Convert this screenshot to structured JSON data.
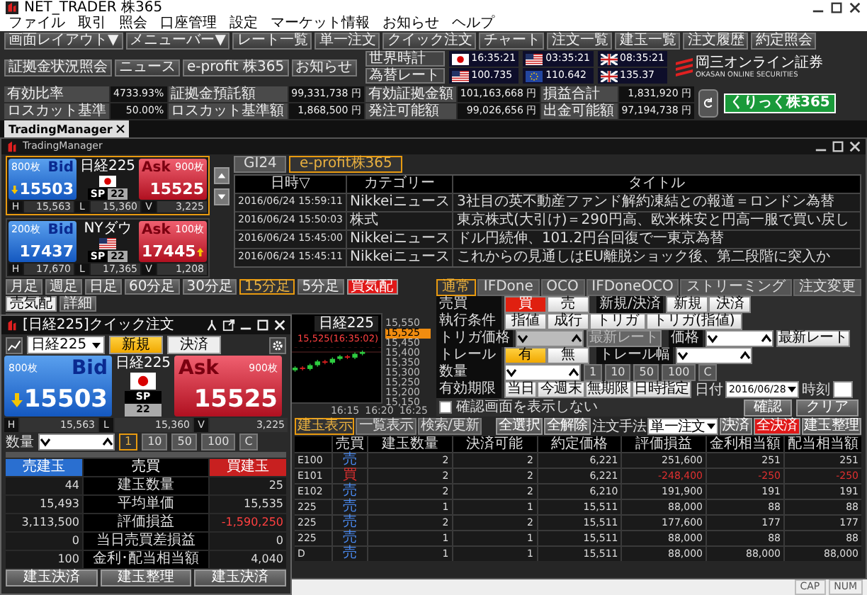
{
  "window": {
    "title": "NET_TRADER 株365"
  },
  "menu": [
    "ファイル",
    "取引",
    "照会",
    "口座管理",
    "設定",
    "マーケット情報",
    "お知らせ",
    "ヘルプ"
  ],
  "toolbar": [
    "画面レイアウト▼",
    "メニューバー▼",
    "レート一覧",
    "単一注文",
    "クイック注文",
    "チャート",
    "注文一覧",
    "建玉一覧",
    "注文履歴",
    "約定照会",
    "証拠金状況照会",
    "ニュース",
    "e-profit 株365",
    "お知らせ"
  ],
  "clocks": {
    "world_label": "世界時計",
    "times": [
      {
        "kind": "japan",
        "value": "16:35:21"
      },
      {
        "kind": "usa",
        "value": "03:35:21"
      },
      {
        "kind": "uk",
        "value": "08:35:21"
      }
    ],
    "fx_label": "為替レート",
    "rates": [
      {
        "kind": "usa",
        "value": "100.735"
      },
      {
        "kind": "eu",
        "value": "110.642"
      },
      {
        "kind": "uk",
        "value": "135.37"
      }
    ]
  },
  "logos": {
    "broker": "岡三オンライン証券",
    "broker_sub": "OKASAN ONLINE SECURITIES",
    "product": "くりっく株365"
  },
  "account": [
    {
      "label": "有効比率",
      "value": "4733.93%"
    },
    {
      "label": "証拠金預託額",
      "value": "99,331,738 円"
    },
    {
      "label": "有効証拠金額",
      "value": "101,163,668 円"
    },
    {
      "label": "損益合計",
      "value": "1,831,920 円"
    },
    {
      "label": "ロスカット基準",
      "value": "50.00%"
    },
    {
      "label": "ロスカット基準額",
      "value": "1,868,500 円"
    },
    {
      "label": "発注可能額",
      "value": "99,026,656 円"
    },
    {
      "label": "出金可能額",
      "value": "97,194,738 円"
    }
  ],
  "document_tabs": [
    {
      "label": "TradingManager",
      "selected": true
    }
  ],
  "trading_manager": {
    "title": "TradingManager",
    "quotes": [
      {
        "selected": true,
        "bid_qty": "800枚",
        "bid_label": "Bid",
        "bid": "15503",
        "bid_arrow": {
          "kind": "down"
        },
        "name": "日経225",
        "flag": {
          "kind": "japan"
        },
        "sp_label": "SP",
        "sp": "22",
        "ask_label": "Ask",
        "ask_qty": "900枚",
        "ask": "15525",
        "stats": [
          {
            "label": "H",
            "value": "15,563"
          },
          {
            "label": "L",
            "value": "15,360"
          },
          {
            "label": "V",
            "value": "3,225"
          }
        ]
      },
      {
        "selected": false,
        "bid_qty": "200枚",
        "bid_label": "Bid",
        "bid": "17437",
        "name": "NYダウ",
        "flag": {
          "kind": "usa"
        },
        "sp_label": "SP",
        "sp": "22",
        "ask_label": "Ask",
        "ask_qty": "100枚",
        "ask": "17445",
        "ask_arrow": {
          "kind": "up"
        },
        "stats": [
          {
            "label": "H",
            "value": "17,670"
          },
          {
            "label": "L",
            "value": "17,365"
          },
          {
            "label": "V",
            "value": "1,208"
          }
        ]
      }
    ],
    "news": {
      "tabs": [
        {
          "label": "GI24",
          "selected": false
        },
        {
          "label": "e-profit株365",
          "selected": true
        }
      ],
      "columns": [
        "日時▽",
        "カテゴリー",
        "タイトル"
      ],
      "rows": [
        {
          "time": "2016/06/24 15:59:11",
          "category": "Nikkeiニュース",
          "title": "3社目の英不動産ファンド解約凍結との報道＝ロンドン為替"
        },
        {
          "time": "2016/06/24 15:50:03",
          "category": "株式",
          "title": "東京株式(大引け)＝290円高、欧米株安と円高一服で買い戻し"
        },
        {
          "time": "2016/06/24 15:45:00",
          "category": "Nikkeiニュース",
          "title": "ドル円続伸、101.2円台回復で一東京為替"
        },
        {
          "time": "2016/06/24 15:45:11",
          "category": "Nikkeiニュース",
          "title": "これからの見通しはEU離脱ショック後、第二段階に突入か"
        }
      ]
    },
    "chart": {
      "timeframes": [
        {
          "label": "月足",
          "selected": false
        },
        {
          "label": "週足",
          "selected": false
        },
        {
          "label": "日足",
          "selected": false
        },
        {
          "label": "60分足",
          "selected": false
        },
        {
          "label": "30分足",
          "selected": false
        },
        {
          "label": "15分足",
          "selected": true
        },
        {
          "label": "5分足",
          "selected": false
        }
      ],
      "sides": [
        {
          "label": "買気配",
          "selected": true
        },
        {
          "label": "売気配",
          "selected": false
        }
      ],
      "detail": "詳細",
      "title": "日経225",
      "price_marker": "15,525(16:35:02)",
      "y_labels": [
        {
          "label": "15,550",
          "current": false
        },
        {
          "label": "15,525",
          "current": true
        },
        {
          "label": "15,450",
          "current": false
        },
        {
          "label": "15,400",
          "current": false
        },
        {
          "label": "15,350",
          "current": false
        },
        {
          "label": "15,300",
          "current": false
        },
        {
          "label": "15,250",
          "current": false
        },
        {
          "label": "15,200",
          "current": false
        },
        {
          "label": "15,150",
          "current": false
        }
      ],
      "x_labels": [
        "16:15",
        "16:20",
        "16:25"
      ]
    },
    "order": {
      "tabs": [
        {
          "label": "通常",
          "selected": true
        },
        {
          "label": "IFDone",
          "selected": false
        },
        {
          "label": "OCO",
          "selected": false
        },
        {
          "label": "IFDoneOCO",
          "selected": false
        },
        {
          "label": "ストリーミング",
          "selected": false
        },
        {
          "label": "注文変更",
          "selected": false
        }
      ],
      "side": {
        "label": "売買",
        "options": [
          {
            "label": "買",
            "selected": true
          },
          {
            "label": "売",
            "selected": false
          }
        ]
      },
      "open_close": {
        "label": "新規/決済",
        "options": [
          {
            "label": "新規",
            "selected": false
          },
          {
            "label": "決済",
            "selected": false
          }
        ]
      },
      "condition": {
        "label": "執行条件",
        "options": [
          {
            "label": "指値",
            "selected": false
          },
          {
            "label": "成行",
            "selected": false
          },
          {
            "label": "トリガ",
            "selected": false
          },
          {
            "label": "トリガ(指値)",
            "selected": false
          }
        ]
      },
      "trigger": {
        "label": "トリガ価格",
        "button": "最新レート",
        "disabled": true
      },
      "price": {
        "label": "価格",
        "button": "最新レート",
        "disabled": false
      },
      "trail": {
        "label": "トレール",
        "options": [
          {
            "label": "有",
            "selected": true
          },
          {
            "label": "無",
            "selected": false
          }
        ]
      },
      "trail_width": {
        "label": "トレール幅"
      },
      "quantity": {
        "label": "数量",
        "presets": [
          {
            "label": "1",
            "selected": false
          },
          {
            "label": "10",
            "selected": false
          },
          {
            "label": "50",
            "selected": false
          },
          {
            "label": "100",
            "selected": false
          },
          {
            "label": "C",
            "selected": false
          }
        ]
      },
      "expiry": {
        "label": "有効期限",
        "options": [
          {
            "label": "当日",
            "selected": false
          },
          {
            "label": "今週末",
            "selected": false
          },
          {
            "label": "無期限",
            "selected": false
          },
          {
            "label": "日時指定",
            "selected": false
          }
        ],
        "date_label": "日付",
        "date": "2016/06/28",
        "time_label": "時刻"
      },
      "skip_confirm": {
        "label": "確認画面を表示しない",
        "checked": false
      },
      "buttons": [
        "確認",
        "クリア"
      ]
    },
    "positions": {
      "views": [
        {
          "label": "建玉表示",
          "selected": true
        },
        {
          "label": "一覧表示",
          "selected": false
        },
        {
          "label": "検索/更新",
          "selected": false
        }
      ],
      "actions": [
        {
          "kind": "button",
          "label": "全選択"
        },
        {
          "kind": "button",
          "label": "全解除"
        },
        {
          "kind": "label",
          "label": "注文手法"
        },
        {
          "kind": "select",
          "label": "単一注文"
        },
        {
          "kind": "button",
          "label": "決済"
        },
        {
          "kind": "danger",
          "label": "全決済"
        },
        {
          "kind": "button",
          "label": "建玉整理"
        }
      ],
      "columns": [
        "売買",
        "建玉数量",
        "決済可能",
        "約定価格",
        "評価損益",
        "金利相当額",
        "配当相当額"
      ],
      "rows": [
        {
          "column_1": "E100",
          "side": "売",
          "kind": "sell",
          "qty": "2",
          "closable": "2",
          "price": "6,221",
          "pl": "251,600",
          "interest": "251",
          "dividend": "251",
          "negative": false
        },
        {
          "column_1": "E101",
          "side": "買",
          "kind": "buy",
          "qty": "2",
          "closable": "2",
          "price": "6,221",
          "pl": "-248,400",
          "interest": "-250",
          "dividend": "-250",
          "negative": true
        },
        {
          "column_1": "E102",
          "side": "売",
          "kind": "sell",
          "qty": "2",
          "closable": "2",
          "price": "6,210",
          "pl": "191,900",
          "interest": "191",
          "dividend": "191",
          "negative": false
        },
        {
          "column_1": "225",
          "side": "売",
          "kind": "sell",
          "qty": "1",
          "closable": "1",
          "price": "15,511",
          "pl": "88,000",
          "interest": "88",
          "dividend": "88",
          "negative": false
        },
        {
          "column_1": "225",
          "side": "売",
          "kind": "sell",
          "qty": "2",
          "closable": "2",
          "price": "15,511",
          "pl": "177,600",
          "interest": "177",
          "dividend": "177",
          "negative": false
        },
        {
          "column_1": "225",
          "side": "売",
          "kind": "sell",
          "qty": "1",
          "closable": "1",
          "price": "15,511",
          "pl": "88,000",
          "interest": "88",
          "dividend": "88",
          "negative": false
        },
        {
          "column_1": "D",
          "side": "売",
          "kind": "sell",
          "qty": "1",
          "closable": "1",
          "price": "15,511",
          "pl": "88,000",
          "interest": "88,000",
          "dividend": "88,000",
          "negative": false
        }
      ]
    }
  },
  "quick_order": {
    "title": "[日経225]クイック注文",
    "symbol": "日経225",
    "modes": [
      {
        "label": "新規",
        "selected": true
      },
      {
        "label": "決済",
        "selected": false
      }
    ],
    "quote": {
      "bid_qty": "800枚",
      "bid_label": "Bid",
      "bid": "15503",
      "bid_arrow": {
        "kind": "down"
      },
      "name": "日経225",
      "flag": {
        "kind": "japan"
      },
      "sp_label": "SP",
      "sp": "22",
      "ask_label": "Ask",
      "ask_qty": "900枚",
      "ask": "15525",
      "stats": [
        {
          "label": "H",
          "value": "15,563"
        },
        {
          "label": "L",
          "value": "15,360"
        },
        {
          "label": "V",
          "value": "3,225"
        }
      ]
    },
    "quantity_label": "数量",
    "presets": [
      {
        "label": "1",
        "selected": true
      },
      {
        "label": "10",
        "selected": false
      },
      {
        "label": "50",
        "selected": false
      },
      {
        "label": "100",
        "selected": false
      },
      {
        "label": "C",
        "selected": false
      }
    ],
    "headers": [
      {
        "label": "売建玉",
        "kind": "sell"
      },
      {
        "label": "売買",
        "kind": "plain"
      },
      {
        "label": "買建玉",
        "kind": "buy"
      }
    ],
    "rows": [
      {
        "sell": "44",
        "label": "建玉数量",
        "buy": "25",
        "buy_negative": false
      },
      {
        "sell": "15,493",
        "label": "平均単価",
        "buy": "15,535",
        "buy_negative": false
      },
      {
        "sell": "3,113,500",
        "label": "評価損益",
        "buy": "-1,590,250",
        "buy_negative": true
      },
      {
        "sell": "0",
        "label": "当日売買差損益",
        "buy": "0",
        "buy_negative": false
      },
      {
        "sell": "100",
        "label": "金利･配当相当額",
        "buy": "4,040",
        "buy_negative": false
      }
    ],
    "buttons": [
      "建玉決済",
      "建玉整理",
      "建玉決済"
    ]
  },
  "status_bar": [
    "CAP",
    "NUM"
  ]
}
